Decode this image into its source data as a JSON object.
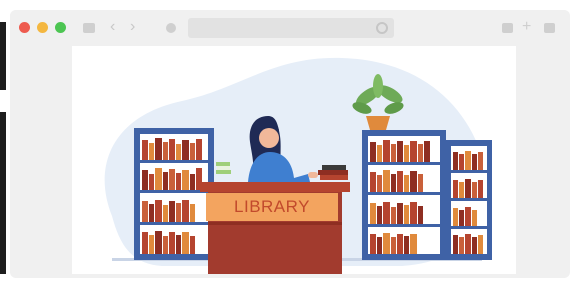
{
  "window": {
    "controls": [
      "close-dot",
      "minimize-dot",
      "maximize-dot"
    ],
    "icons": {
      "sidebar": "square-icon",
      "back": "chevron-left-icon",
      "forward": "chevron-right-icon",
      "site": "circle-icon",
      "reload": "reload-icon",
      "share": "square-icon",
      "new_tab": "plus-icon",
      "tabs": "copy-icon"
    },
    "back_glyph": "‹",
    "forward_glyph": "›",
    "plus_glyph": "+",
    "address_value": ""
  },
  "illustration": {
    "sign_text": "LIBRARY",
    "colors": {
      "shelf_blue": "#3f62a6",
      "desk_red": "#a23b2e",
      "sign_orange": "#f3a45f",
      "blob_blue": "#e6eef8",
      "plant_green": "#6eaa57"
    }
  }
}
